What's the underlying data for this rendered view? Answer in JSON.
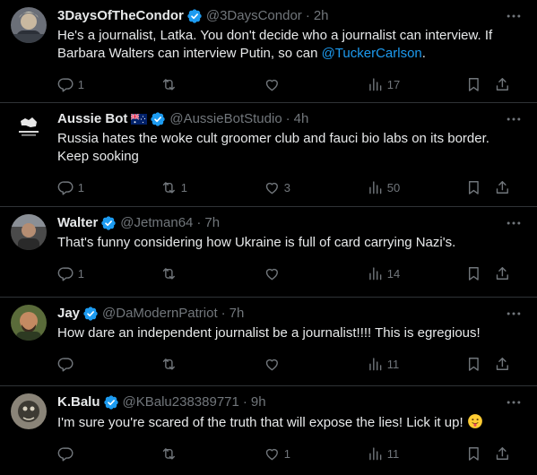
{
  "colors": {
    "background": "#000000",
    "text": "#e7e9ea",
    "muted": "#71767b",
    "accent": "#1d9bf0",
    "divider": "#2f3336"
  },
  "tweets": [
    {
      "name": "3DaysOfTheCondor",
      "handle": "@3DaysCondor",
      "time": "2h",
      "verified": true,
      "text_before": "He's a journalist, Latka. You don't decide who a journalist can interview. If Barbara Walters can interview Putin, so can ",
      "mention": "@TuckerCarlson",
      "text_after": ".",
      "replies": "1",
      "retweets": "",
      "likes": "",
      "views": "17"
    },
    {
      "name": "Aussie Bot",
      "flag": "australia-flag",
      "handle": "@AussieBotStudio",
      "time": "4h",
      "verified": true,
      "text": "Russia hates the woke cult groomer club and fauci bio labs on its border. Keep sooking",
      "replies": "1",
      "retweets": "1",
      "likes": "3",
      "views": "50"
    },
    {
      "name": "Walter",
      "handle": "@Jetman64",
      "time": "7h",
      "verified": true,
      "text": "That's funny considering how Ukraine is full of card carrying Nazi's.",
      "replies": "1",
      "retweets": "",
      "likes": "",
      "views": "14"
    },
    {
      "name": "Jay",
      "handle": "@DaModernPatriot",
      "time": "7h",
      "verified": true,
      "text": "How dare an independent journalist be a journalist!!!! This is egregious!",
      "replies": "",
      "retweets": "",
      "likes": "",
      "views": "11"
    },
    {
      "name": "K.Balu",
      "handle": "@KBalu238389771",
      "time": "9h",
      "verified": true,
      "text": "I'm sure you're scared of the truth that will expose the lies! Lick it up!",
      "emoji": "tongue-out-emoji",
      "replies": "",
      "retweets": "",
      "likes": "1",
      "views": "11"
    }
  ],
  "separator": "·"
}
